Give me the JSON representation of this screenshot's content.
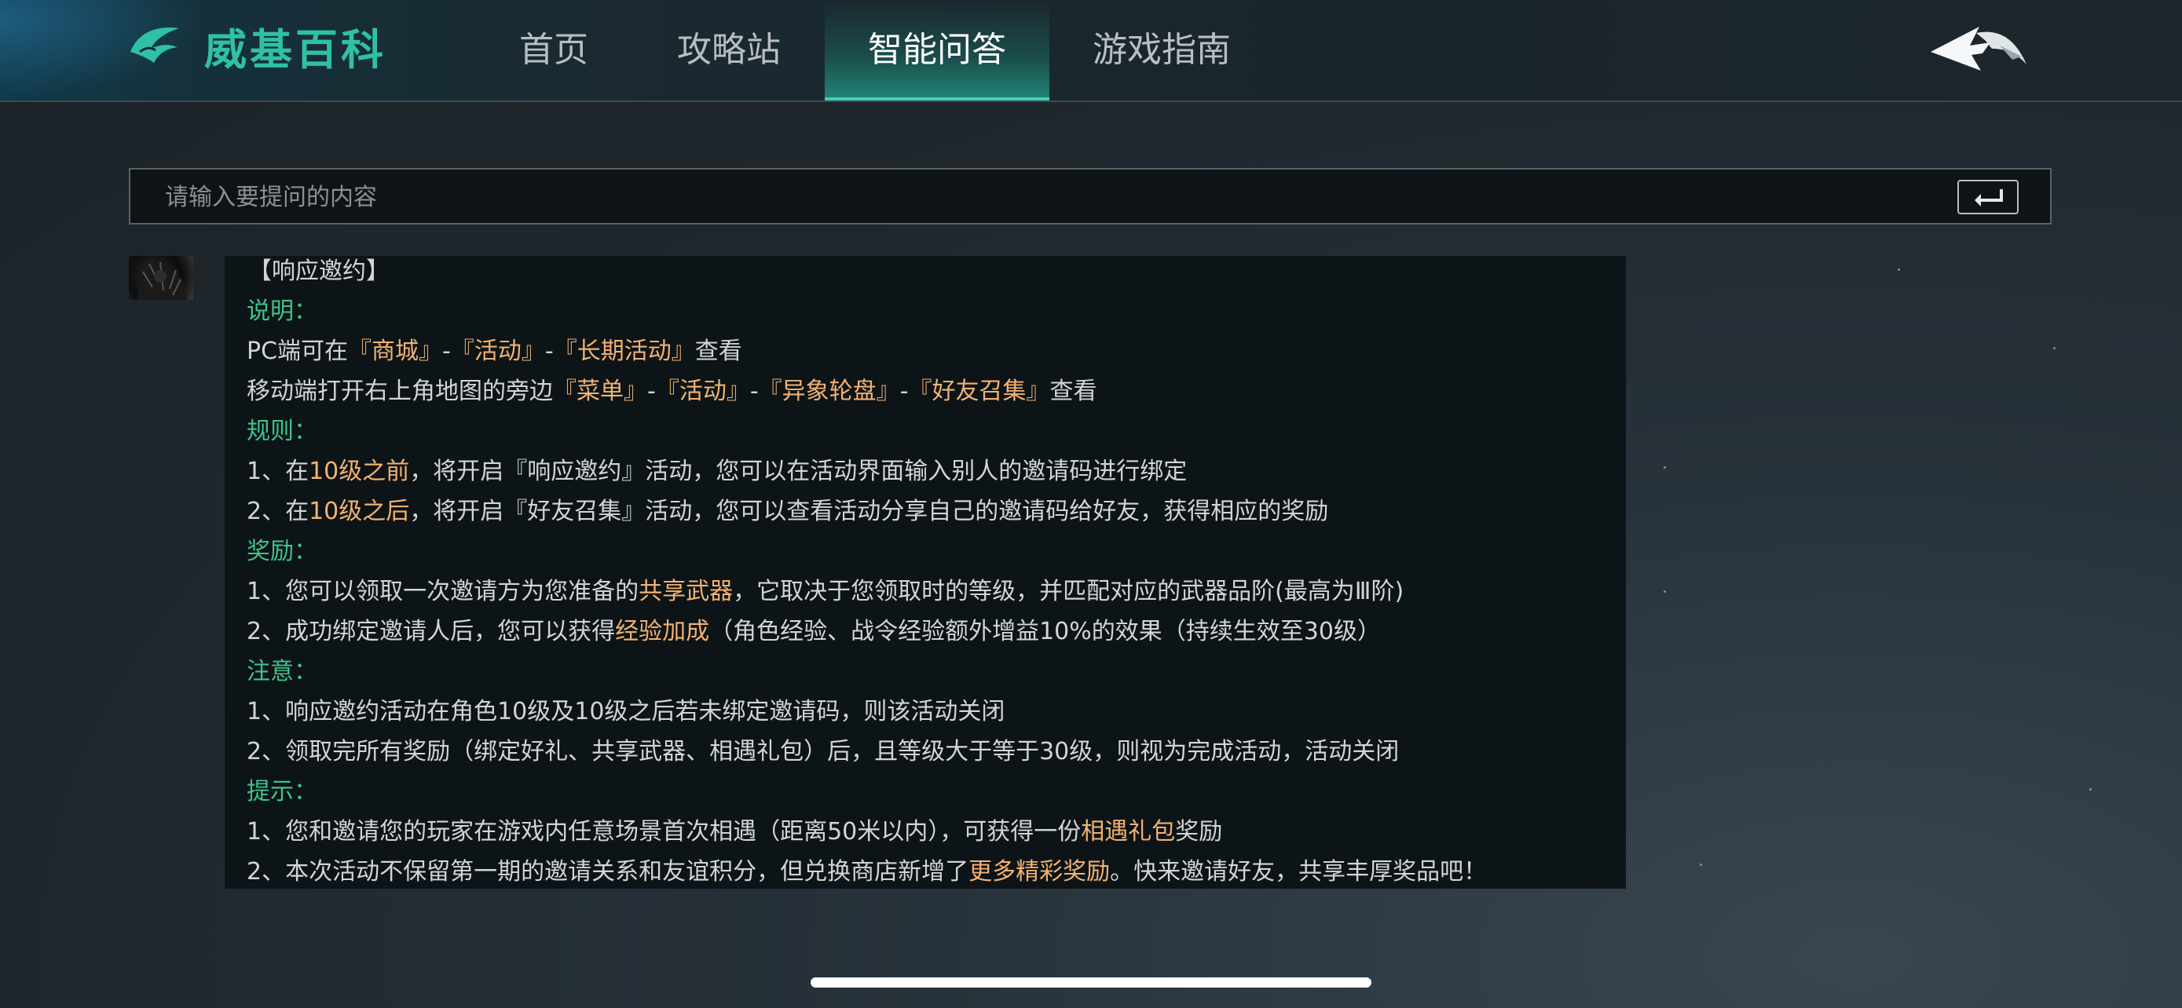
{
  "app": {
    "brand": "威基百科",
    "logo_icon": "wing-logo-icon",
    "back_icon": "back-arrow-icon"
  },
  "nav": {
    "tabs": [
      {
        "label": "首页",
        "active": false
      },
      {
        "label": "攻略站",
        "active": false
      },
      {
        "label": "智能问答",
        "active": true
      },
      {
        "label": "游戏指南",
        "active": false
      }
    ]
  },
  "search": {
    "placeholder": "请输入要提问的内容",
    "value": "",
    "submit_icon": "enter-return-icon"
  },
  "answer": {
    "title": "【响应邀约】",
    "sections": [
      {
        "heading": "说明：",
        "lines": [
          [
            {
              "t": "PC端可在"
            },
            {
              "t": "『商城』",
              "hl": true
            },
            {
              "t": "-"
            },
            {
              "t": "『活动』",
              "hl": true
            },
            {
              "t": "-"
            },
            {
              "t": "『长期活动』",
              "hl": true
            },
            {
              "t": "查看"
            }
          ],
          [
            {
              "t": "移动端打开右上角地图的旁边"
            },
            {
              "t": "『菜单』",
              "hl": true
            },
            {
              "t": "-"
            },
            {
              "t": "『活动』",
              "hl": true
            },
            {
              "t": "-"
            },
            {
              "t": "『异象轮盘』",
              "hl": true
            },
            {
              "t": "-"
            },
            {
              "t": "『好友召集』",
              "hl": true
            },
            {
              "t": "查看"
            }
          ]
        ]
      },
      {
        "heading": "规则：",
        "lines": [
          [
            {
              "t": "1、在"
            },
            {
              "t": "10级之前",
              "hl": true
            },
            {
              "t": "，将开启『响应邀约』活动，您可以在活动界面输入别人的邀请码进行绑定"
            }
          ],
          [
            {
              "t": "2、在"
            },
            {
              "t": "10级之后",
              "hl": true
            },
            {
              "t": "，将开启『好友召集』活动，您可以查看活动分享自己的邀请码给好友，获得相应的奖励"
            }
          ]
        ]
      },
      {
        "heading": "奖励：",
        "lines": [
          [
            {
              "t": "1、您可以领取一次邀请方为您准备的"
            },
            {
              "t": "共享武器",
              "hl": true
            },
            {
              "t": "，它取决于您领取时的等级，并匹配对应的武器品阶(最高为Ⅲ阶)"
            }
          ],
          [
            {
              "t": "2、成功绑定邀请人后，您可以获得"
            },
            {
              "t": "经验加成",
              "hl": true
            },
            {
              "t": "（角色经验、战令经验额外增益10%的效果（持续生效至30级）"
            }
          ]
        ]
      },
      {
        "heading": "注意：",
        "lines": [
          [
            {
              "t": "1、响应邀约活动在角色10级及10级之后若未绑定邀请码，则该活动关闭"
            }
          ],
          [
            {
              "t": "2、领取完所有奖励（绑定好礼、共享武器、相遇礼包）后，且等级大于等于30级，则视为完成活动，活动关闭"
            }
          ]
        ]
      },
      {
        "heading": "提示：",
        "lines": [
          [
            {
              "t": "1、您和邀请您的玩家在游戏内任意场景首次相遇（距离50米以内），可获得一份"
            },
            {
              "t": "相遇礼包",
              "hl": true
            },
            {
              "t": "奖励"
            }
          ],
          [
            {
              "t": "2、本次活动不保留第一期的邀请关系和友谊积分，但兑换商店新增了"
            },
            {
              "t": "更多精彩奖励",
              "hl": true
            },
            {
              "t": "。快来邀请好友，共享丰厚奖品吧！"
            }
          ]
        ]
      }
    ]
  },
  "colors": {
    "brand": "#2fc0a5",
    "section_heading": "#3ec48c",
    "highlight": "#f2b270",
    "active_tab": "#3cd2b5"
  }
}
